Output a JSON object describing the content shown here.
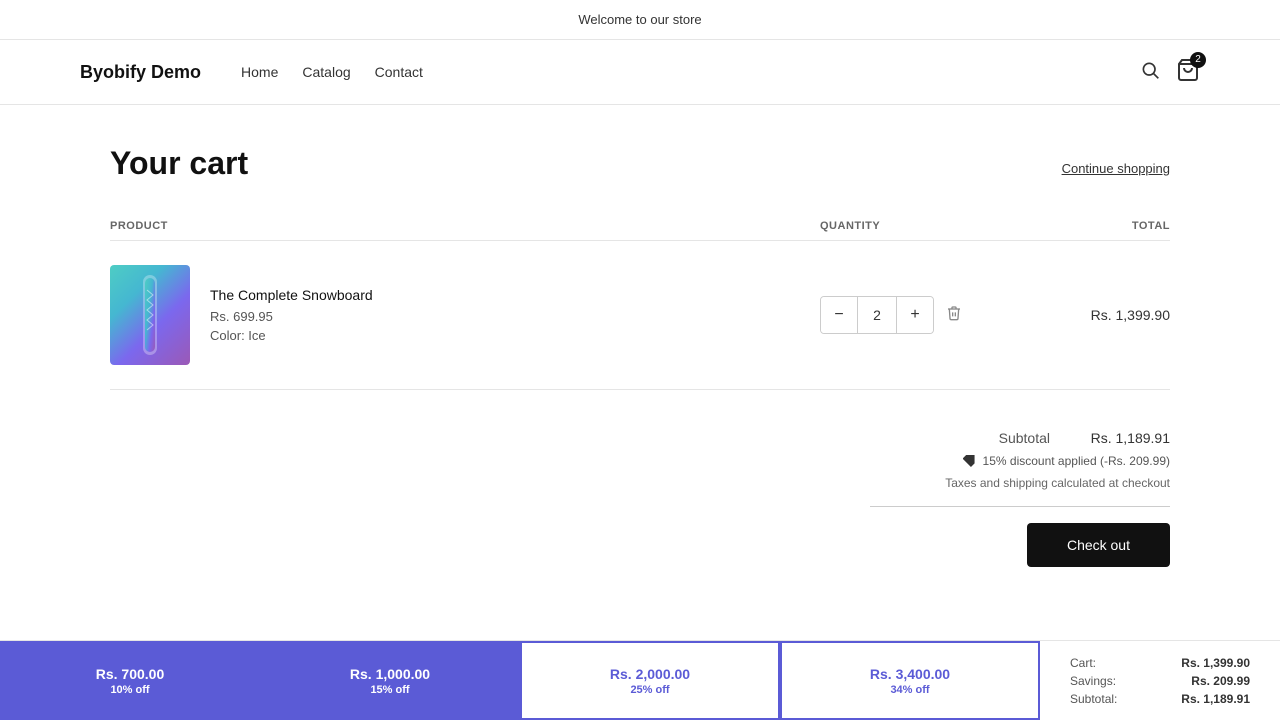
{
  "banner": {
    "text": "Welcome to our store"
  },
  "header": {
    "brand": "Byobify Demo",
    "nav": [
      {
        "label": "Home"
      },
      {
        "label": "Catalog"
      },
      {
        "label": "Contact"
      }
    ],
    "cart_count": "2"
  },
  "cart": {
    "title": "Your cart",
    "continue_shopping": "Continue shopping",
    "columns": {
      "product": "PRODUCT",
      "quantity": "QUANTITY",
      "total": "TOTAL"
    },
    "items": [
      {
        "name": "The Complete Snowboard",
        "price": "Rs. 699.95",
        "color": "Color: Ice",
        "quantity": "2",
        "total": "Rs. 1,399.90"
      }
    ],
    "subtotal_label": "Subtotal",
    "subtotal_value": "Rs. 1,189.91",
    "discount_text": "15% discount applied (-Rs. 209.99)",
    "taxes_note": "Taxes and shipping calculated at checkout",
    "checkout_label": "Check out"
  },
  "summary_bar": {
    "cart_label": "Cart:",
    "cart_value": "Rs. 1,399.90",
    "savings_label": "Savings:",
    "savings_value": "Rs. 209.99",
    "subtotal_label": "Subtotal:",
    "subtotal_value": "Rs. 1,189.91"
  },
  "tiers": [
    {
      "amount": "Rs. 700.00",
      "discount": "10% off",
      "style": "filled"
    },
    {
      "amount": "Rs. 1,000.00",
      "discount": "15% off",
      "style": "filled"
    },
    {
      "amount": "Rs. 2,000.00",
      "discount": "25% off",
      "style": "outline"
    },
    {
      "amount": "Rs. 3,400.00",
      "discount": "34% off",
      "style": "outline"
    }
  ]
}
